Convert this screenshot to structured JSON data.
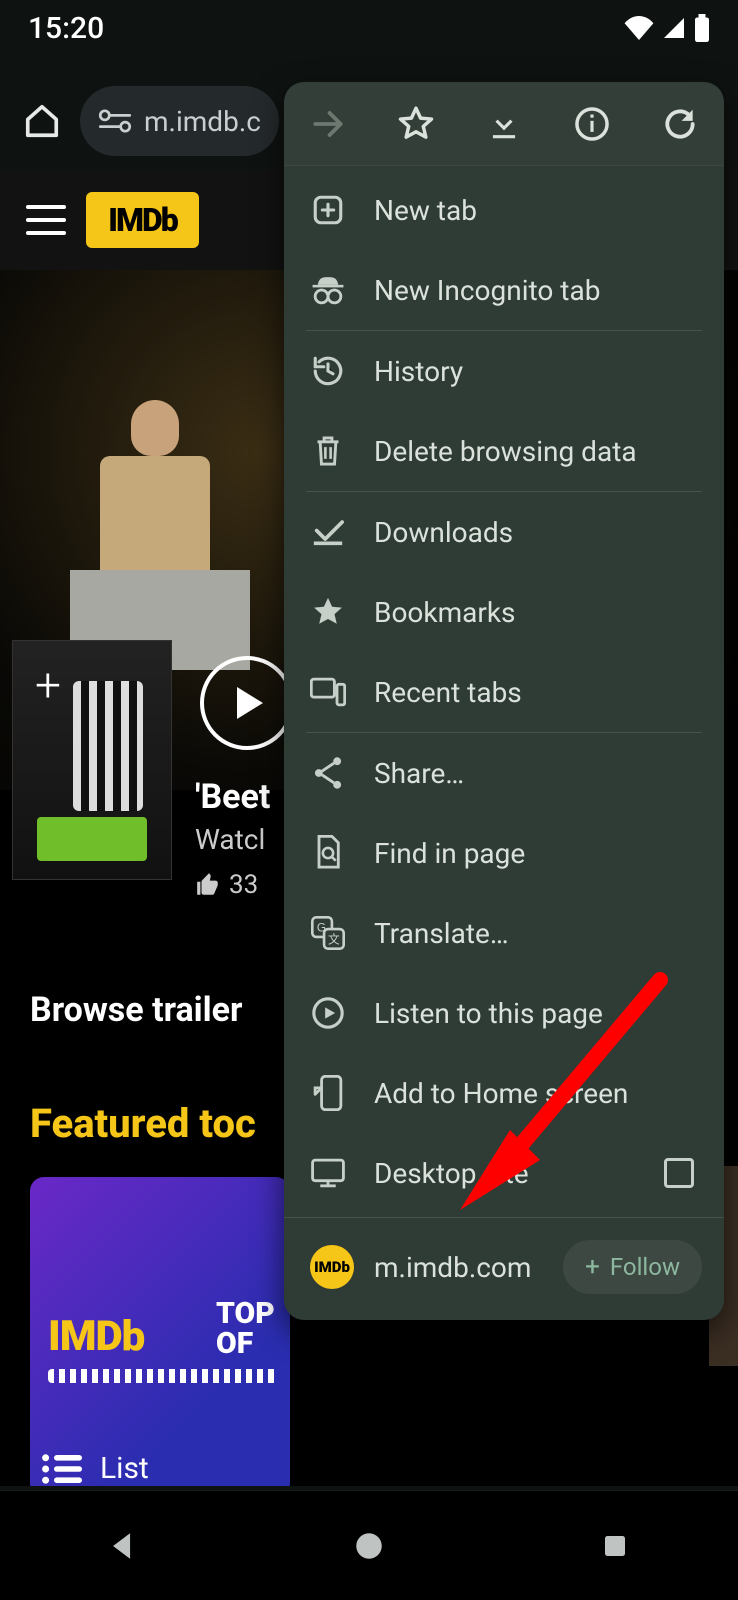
{
  "status": {
    "time": "15:20"
  },
  "browser": {
    "url_display": "m.imdb.c"
  },
  "imdb": {
    "hero_title": "'Beet",
    "hero_subtitle": "Watcl",
    "hero_like_count": "33",
    "browse_heading": "Browse trailer",
    "featured_heading": "Featured toc",
    "card_word1": "IMDb",
    "card_word2": "TOP",
    "card_word3": "OF",
    "list_label": "List"
  },
  "menu": {
    "items": [
      {
        "label": "New tab"
      },
      {
        "label": "New Incognito tab"
      },
      {
        "label": "History"
      },
      {
        "label": "Delete browsing data"
      },
      {
        "label": "Downloads"
      },
      {
        "label": "Bookmarks"
      },
      {
        "label": "Recent tabs"
      },
      {
        "label": "Share…"
      },
      {
        "label": "Find in page"
      },
      {
        "label": "Translate…"
      },
      {
        "label": "Listen to this page"
      },
      {
        "label": "Add to Home screen"
      },
      {
        "label": "Desktop site"
      }
    ],
    "site_domain": "m.imdb.com",
    "follow_label": "Follow"
  }
}
